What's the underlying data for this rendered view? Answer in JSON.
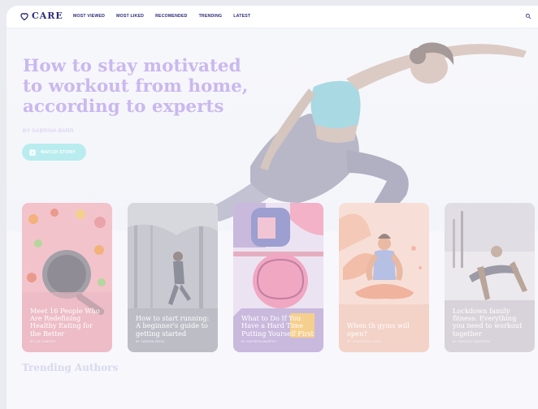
{
  "brand": {
    "name": "CARE",
    "accent": "#2a2a7a"
  },
  "nav": {
    "items": [
      {
        "label": "MOST VIEWED"
      },
      {
        "label": "MOST LIKED"
      },
      {
        "label": "RECOMENDED"
      },
      {
        "label": "TRENDING"
      },
      {
        "label": "LATEST"
      }
    ],
    "search_icon": "search-icon"
  },
  "hero": {
    "title": "How to stay motivated to workout from home, according to experts",
    "author": "BY SABRINA BARR",
    "cta_label": "WATCH STORY",
    "cta_icon": "play-icon"
  },
  "cards": [
    {
      "title": "Meet 16 People Who Are Redefining Healthy Eating for the Better",
      "author": "BY LIZ CONNOR"
    },
    {
      "title": "How to start running: A beginner's guide to getting started",
      "author": "BY VARSHA PATEL"
    },
    {
      "title": "What to Do If You Have a Hard Time Putting Yourself First",
      "author": "BY KATHRYN MURPHY"
    },
    {
      "title": "When th gyms will open?",
      "author": "BY JONATHAN CLARK"
    },
    {
      "title": "Lockdown family fitness: Everything you need to workout together",
      "author": "BY FARIDEH SADEGHIN"
    }
  ],
  "trending": {
    "title": "Trending Authors"
  }
}
